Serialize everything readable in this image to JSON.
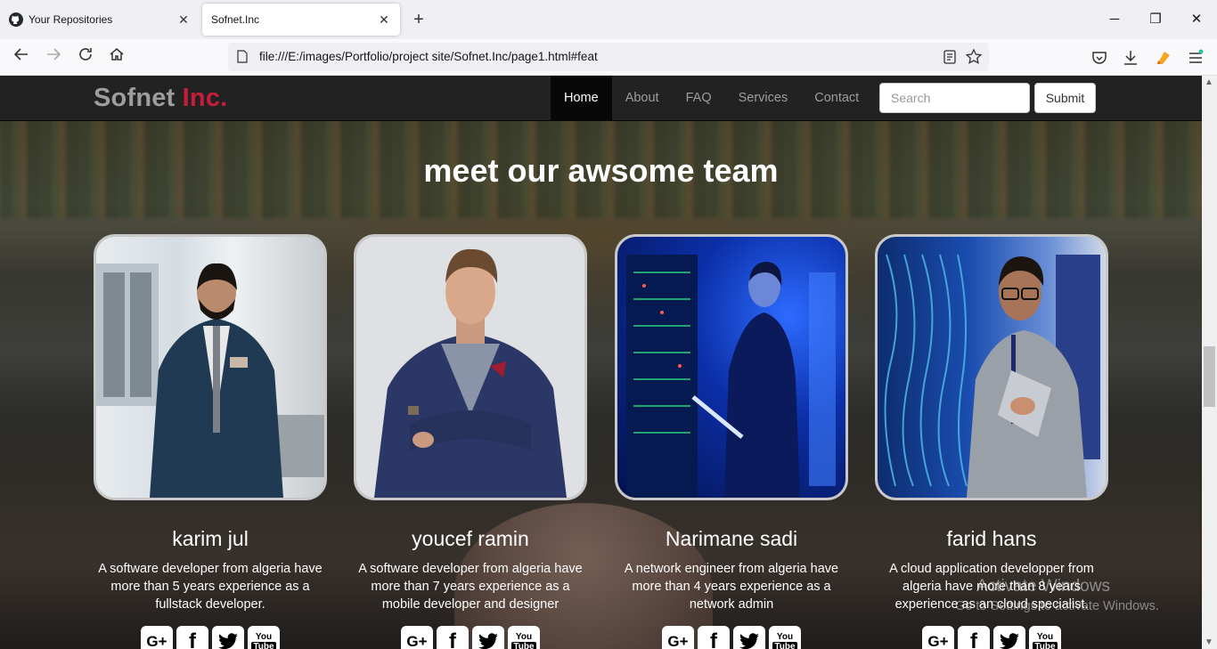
{
  "browser": {
    "tabs": [
      {
        "title": "Your Repositories",
        "favicon": "github-icon"
      },
      {
        "title": "Sofnet.Inc",
        "favicon": "none"
      }
    ],
    "new_tab_label": "+",
    "url": "file:///E:/images/Portfolio/project site/Sofnet.Inc/page1.html#feat",
    "window_controls": {
      "minimize": "─",
      "restore": "❐",
      "close": "✕"
    }
  },
  "site": {
    "brand_main": "Sofnet ",
    "brand_accent": "Inc.",
    "accent_color": "#c51d3c",
    "menu": [
      "Home",
      "About",
      "FAQ",
      "Services",
      "Contact"
    ],
    "active_menu": "Home",
    "search_placeholder": "Search",
    "submit_label": "Submit"
  },
  "team": {
    "title": "meet our awsome team",
    "members": [
      {
        "name": "karim jul",
        "bio": "A software developer from algeria have more than 5 years experience as a fullstack developer."
      },
      {
        "name": "youcef ramin",
        "bio": "A software developer from algeria have more than 7 years experience as a mobile developer and designer"
      },
      {
        "name": "Narimane sadi",
        "bio": "A network engineer from algeria have more than 4 years experience as a network admin"
      },
      {
        "name": "farid hans",
        "bio": "A cloud application developper from algeria have more than 8 years experience as an cloud specialist."
      }
    ],
    "social_icons": [
      "google-plus-icon",
      "facebook-icon",
      "twitter-icon",
      "youtube-icon"
    ],
    "social_labels": {
      "google": "G+",
      "facebook": "f",
      "youtube_top": "You",
      "youtube_bottom": "Tube"
    }
  },
  "os_watermark": {
    "line1": "Activate Windows",
    "line2": "Go to Settings to activate Windows."
  }
}
